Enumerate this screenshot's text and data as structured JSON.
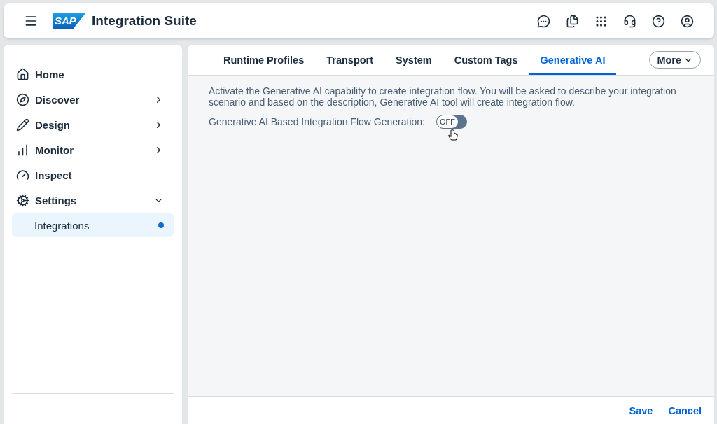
{
  "header": {
    "logo": "SAP",
    "title": "Integration Suite"
  },
  "sidebar": {
    "items": [
      {
        "label": "Home"
      },
      {
        "label": "Discover",
        "expanded": false
      },
      {
        "label": "Design",
        "expanded": false
      },
      {
        "label": "Monitor",
        "expanded": false
      },
      {
        "label": "Inspect"
      },
      {
        "label": "Settings",
        "expanded": true,
        "children": [
          {
            "label": "Integrations",
            "selected": true
          }
        ]
      }
    ]
  },
  "tabs": [
    {
      "label": "Runtime Profiles",
      "selected": false
    },
    {
      "label": "Transport",
      "selected": false
    },
    {
      "label": "System",
      "selected": false
    },
    {
      "label": "Custom Tags",
      "selected": false
    },
    {
      "label": "Generative AI",
      "selected": true
    }
  ],
  "more_button": "More",
  "description": "Activate the Generative AI capability to create integration flow. You will be asked to describe your integration scenario and based on the description, Generative AI tool will create integration flow.",
  "setting": {
    "label": "Generative AI Based Integration Flow Generation:",
    "on": false,
    "state_text": "OFF"
  },
  "footer_buttons": [
    "Save",
    "Cancel"
  ]
}
